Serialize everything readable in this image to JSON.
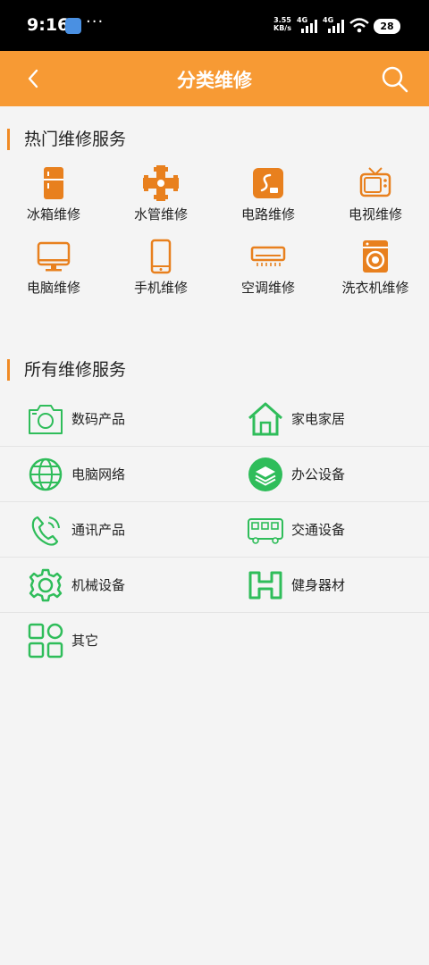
{
  "status_bar": {
    "time": "9:16",
    "dots": "···",
    "speed_value": "3.55",
    "speed_unit": "KB/s",
    "net1": "4G",
    "net2": "4G",
    "battery": "28"
  },
  "header": {
    "title": "分类维修"
  },
  "hot_section": {
    "title": "热门维修服务",
    "items": [
      {
        "label": "冰箱维修",
        "icon": "fridge-icon"
      },
      {
        "label": "水管维修",
        "icon": "pipe-icon"
      },
      {
        "label": "电路维修",
        "icon": "circuit-icon"
      },
      {
        "label": "电视维修",
        "icon": "tv-icon"
      },
      {
        "label": "电脑维修",
        "icon": "monitor-icon"
      },
      {
        "label": "手机维修",
        "icon": "phone-icon"
      },
      {
        "label": "空调维修",
        "icon": "air-conditioner-icon"
      },
      {
        "label": "洗衣机维修",
        "icon": "washing-machine-icon"
      }
    ]
  },
  "all_section": {
    "title": "所有维修服务",
    "items": [
      {
        "label": "数码产品",
        "icon": "camera-icon"
      },
      {
        "label": "家电家居",
        "icon": "home-icon"
      },
      {
        "label": "电脑网络",
        "icon": "globe-icon"
      },
      {
        "label": "办公设备",
        "icon": "layers-icon"
      },
      {
        "label": "通讯产品",
        "icon": "telephone-icon"
      },
      {
        "label": "交通设备",
        "icon": "bus-icon"
      },
      {
        "label": "机械设备",
        "icon": "gear-icon"
      },
      {
        "label": "健身器材",
        "icon": "dumbbell-icon"
      },
      {
        "label": "其它",
        "icon": "grid-icon"
      }
    ]
  },
  "colors": {
    "accent": "#f79a34",
    "hot_icon": "#e8801e",
    "all_icon": "#2fbd5a"
  }
}
